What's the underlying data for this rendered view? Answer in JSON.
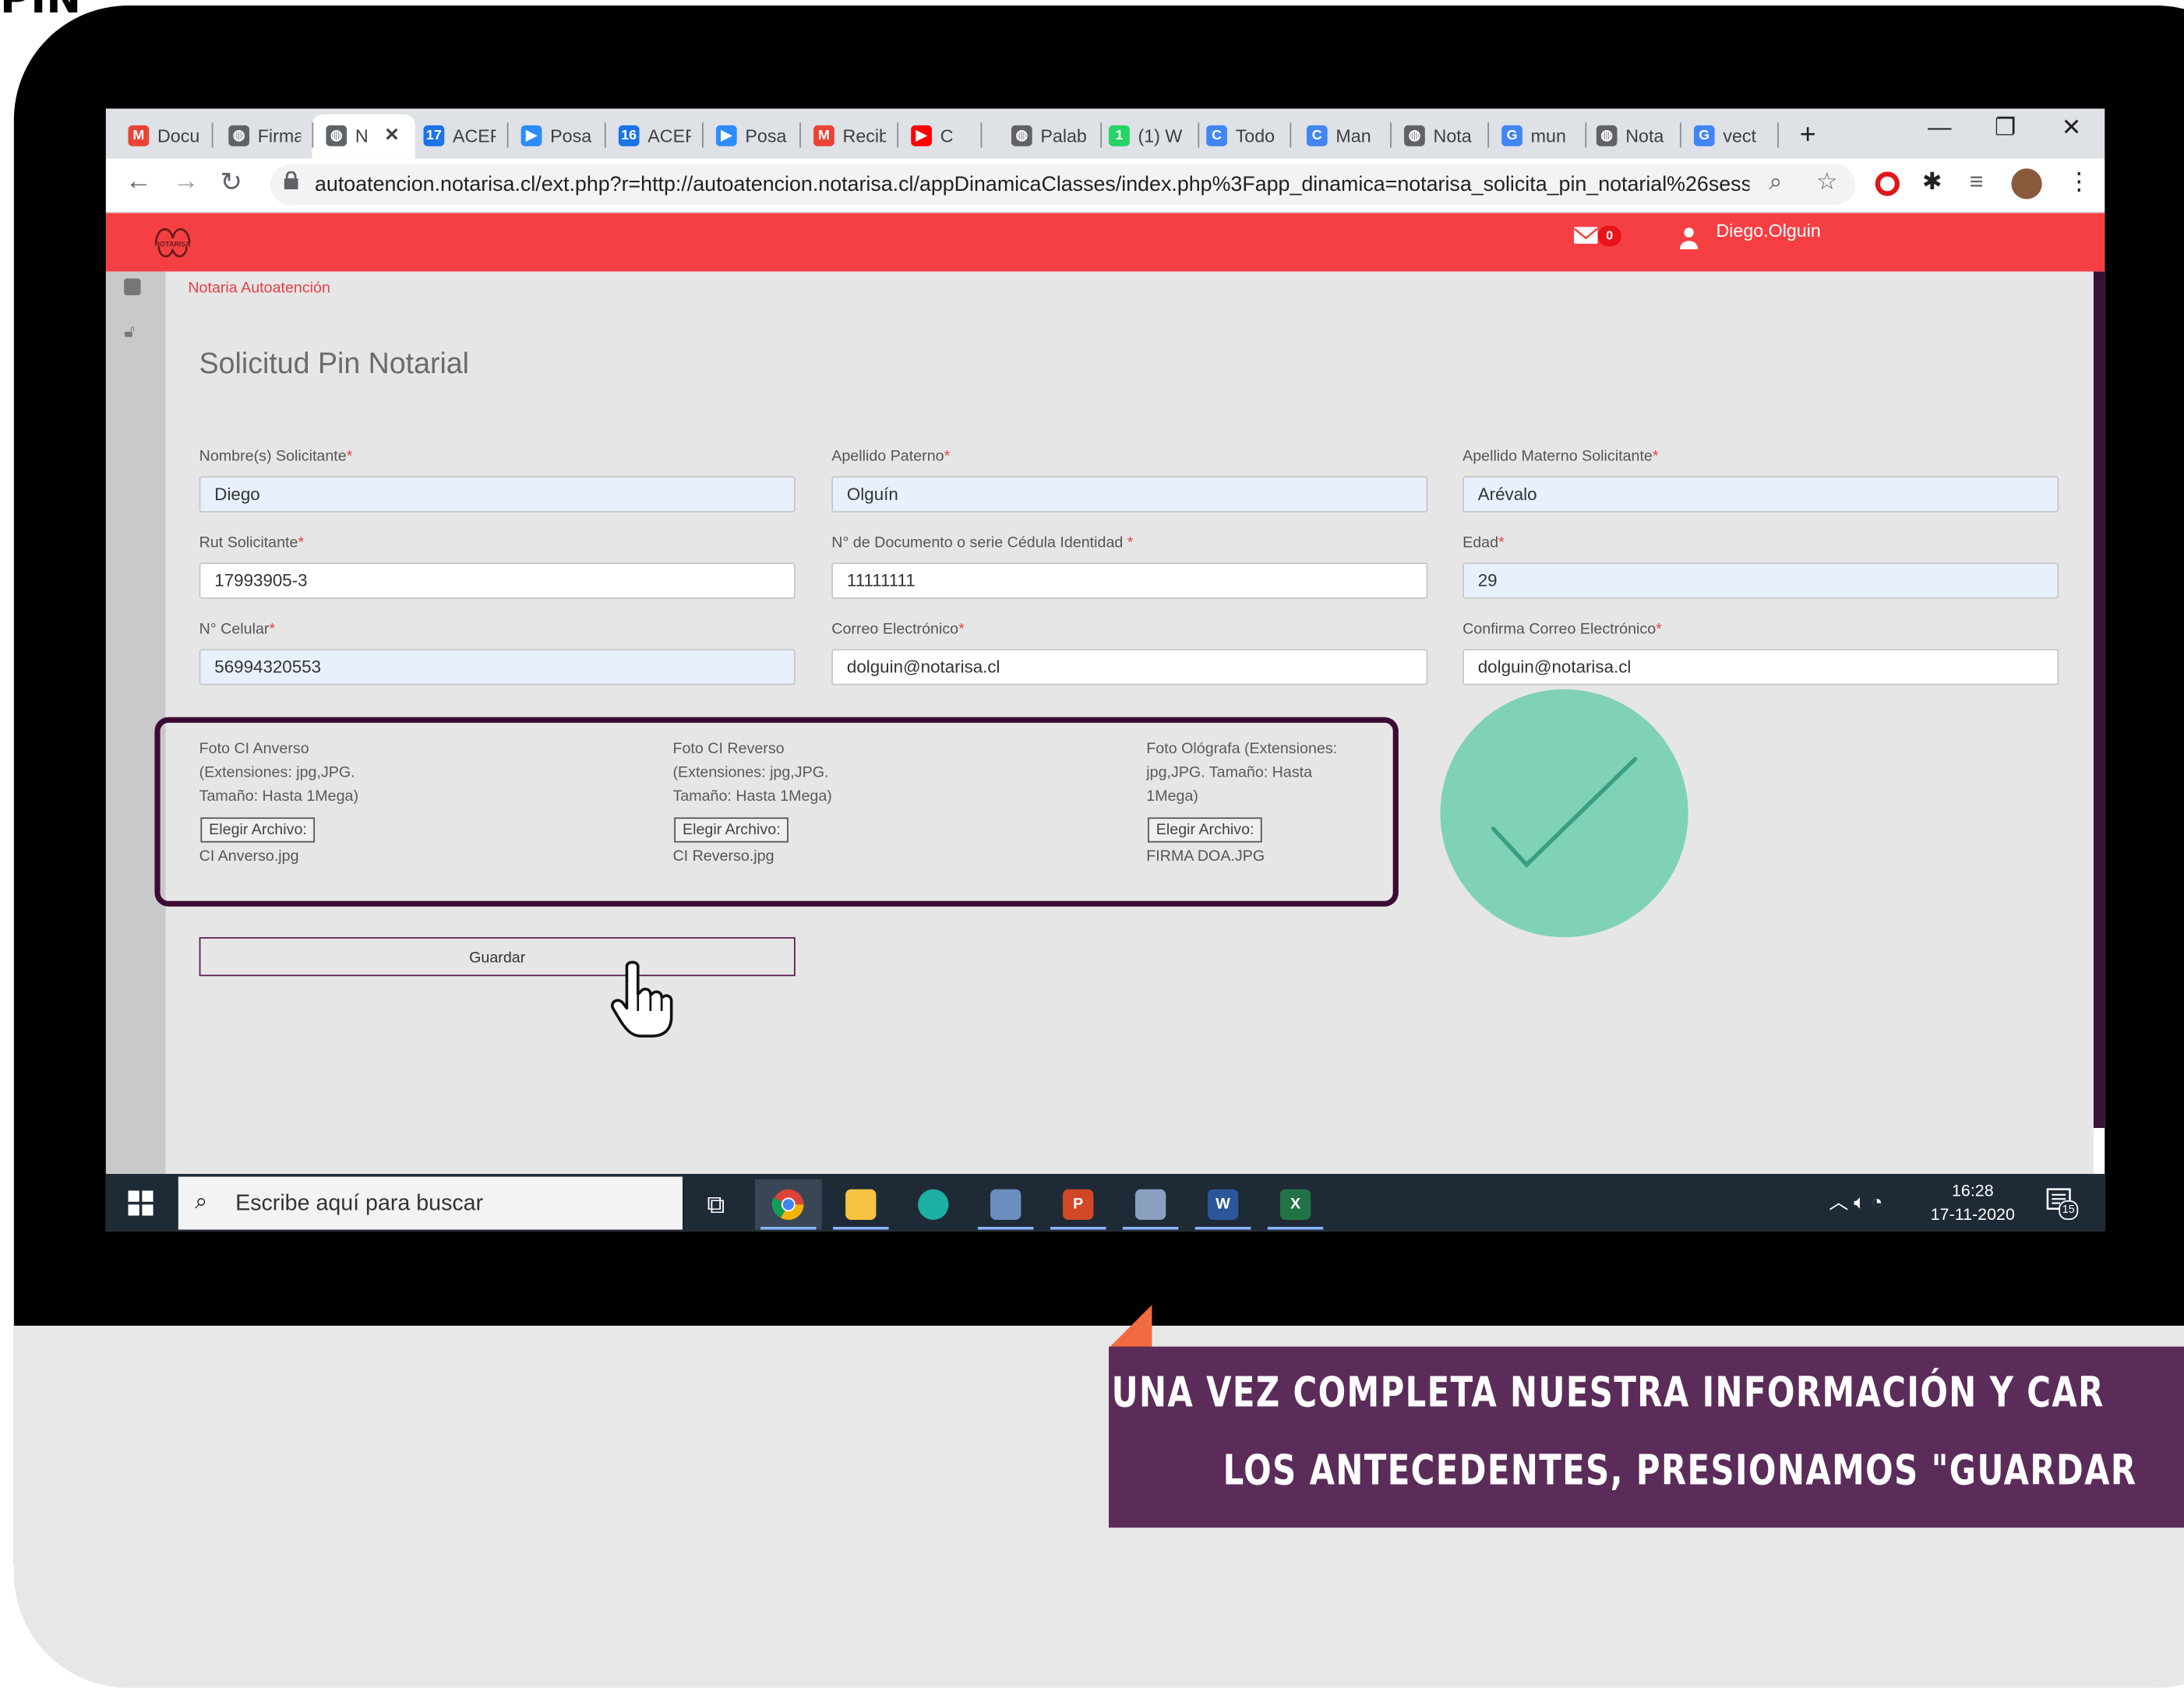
{
  "browser": {
    "tabs": [
      {
        "label": "Docu",
        "icon": "gmail-icon",
        "color": "#ea4335",
        "glyph": "M"
      },
      {
        "label": "Firma",
        "icon": "globe-icon",
        "color": "#5f6368",
        "glyph": "◍"
      },
      {
        "label": "N",
        "icon": "globe-icon",
        "color": "#5f6368",
        "glyph": "◍",
        "active": true
      },
      {
        "label": "ACEP",
        "icon": "calendar-icon",
        "color": "#1a73e8",
        "glyph": "17"
      },
      {
        "label": "Posa",
        "icon": "zoom-icon",
        "color": "#2d8cff",
        "glyph": "▶"
      },
      {
        "label": "ACEP",
        "icon": "calendar-icon",
        "color": "#1a73e8",
        "glyph": "16"
      },
      {
        "label": "Posa",
        "icon": "zoom-icon",
        "color": "#2d8cff",
        "glyph": "▶"
      },
      {
        "label": "Recib",
        "icon": "gmail-icon",
        "color": "#ea4335",
        "glyph": "M"
      },
      {
        "label": "C",
        "icon": "youtube-icon",
        "color": "#ff0000",
        "glyph": "▶"
      },
      {
        "label": "Palab",
        "icon": "globe-icon",
        "color": "#5f6368",
        "glyph": "◍"
      },
      {
        "label": "(1) W",
        "icon": "whatsapp-icon",
        "color": "#25d366",
        "glyph": "1"
      },
      {
        "label": "Todo",
        "icon": "chrome-app-icon",
        "color": "#4285f4",
        "glyph": "C"
      },
      {
        "label": "Man",
        "icon": "chrome-app-icon",
        "color": "#4285f4",
        "glyph": "C"
      },
      {
        "label": "Nota",
        "icon": "globe-icon",
        "color": "#5f6368",
        "glyph": "◍"
      },
      {
        "label": "mun",
        "icon": "google-icon",
        "color": "#4285f4",
        "glyph": "G"
      },
      {
        "label": "Nota",
        "icon": "globe-icon",
        "color": "#5f6368",
        "glyph": "◍"
      },
      {
        "label": "vect",
        "icon": "google-icon",
        "color": "#4285f4",
        "glyph": "G"
      }
    ],
    "new_tab": "+",
    "url": "autoatencion.notarisa.cl/ext.php?r=http://autoatencion.notarisa.cl/appDinamicaClasses/index.php%3Fapp_dinamica=notarisa_solicita_pin_notarial%26session..."
  },
  "app": {
    "logo_text": "NOTARISA",
    "mail_count": "0",
    "username": "Diego.Olguin",
    "breadcrumb": "Notaria Autoatención",
    "page_title": "Solicitud Pin Notarial"
  },
  "form": {
    "fields": {
      "nombre": {
        "label": "Nombre(s) Solicitante",
        "value": "Diego"
      },
      "apellido_paterno": {
        "label": "Apellido Paterno",
        "value": "Olguín"
      },
      "apellido_materno": {
        "label": "Apellido Materno Solicitante",
        "value": "Arévalo"
      },
      "rut": {
        "label": "Rut Solicitante",
        "value": "17993905-3"
      },
      "documento": {
        "label": "N° de Documento o serie Cédula Identidad ",
        "value": "11111111"
      },
      "edad": {
        "label": "Edad",
        "value": "29"
      },
      "celular": {
        "label": "N° Celular",
        "value": "56994320553"
      },
      "correo": {
        "label": "Correo Electrónico",
        "value": "dolguin@notarisa.cl"
      },
      "confirma_correo": {
        "label": "Confirma Correo Electrónico",
        "value": "dolguin@notarisa.cl"
      }
    },
    "required_mark": "*",
    "uploads": [
      {
        "lines": [
          "Foto CI Anverso",
          "(Extensiones: jpg,JPG.",
          "Tamaño: Hasta 1Mega)"
        ],
        "button": "Elegir Archivo:",
        "file": "CI Anverso.jpg"
      },
      {
        "lines": [
          "Foto CI Reverso",
          "(Extensiones: jpg,JPG.",
          "Tamaño: Hasta 1Mega)"
        ],
        "button": "Elegir Archivo:",
        "file": "CI Reverso.jpg"
      },
      {
        "lines": [
          "Foto Ológrafa (Extensiones:",
          "jpg,JPG. Tamaño: Hasta",
          "1Mega)"
        ],
        "button": "Elegir Archivo:",
        "file": "FIRMA DOA.JPG"
      }
    ],
    "submit_label": "Guardar"
  },
  "taskbar": {
    "search_placeholder": "Escribe aquí para buscar",
    "time": "16:28",
    "date": "17-11-2020",
    "notifications": "15"
  },
  "caption": {
    "line1": "UNA VEZ COMPLETA NUESTRA INFORMACIÓN Y CAR",
    "line2": "LOS ANTECEDENTES, PRESIONAMOS \"GUARDAR"
  },
  "corner_fragment": "PIN",
  "colors": {
    "header_red": "#f63f43",
    "frame_purple": "#3b0b33",
    "check_green": "#7fd2b7",
    "caption_purple": "#5b2c59",
    "caption_accent": "#f26a3f"
  }
}
